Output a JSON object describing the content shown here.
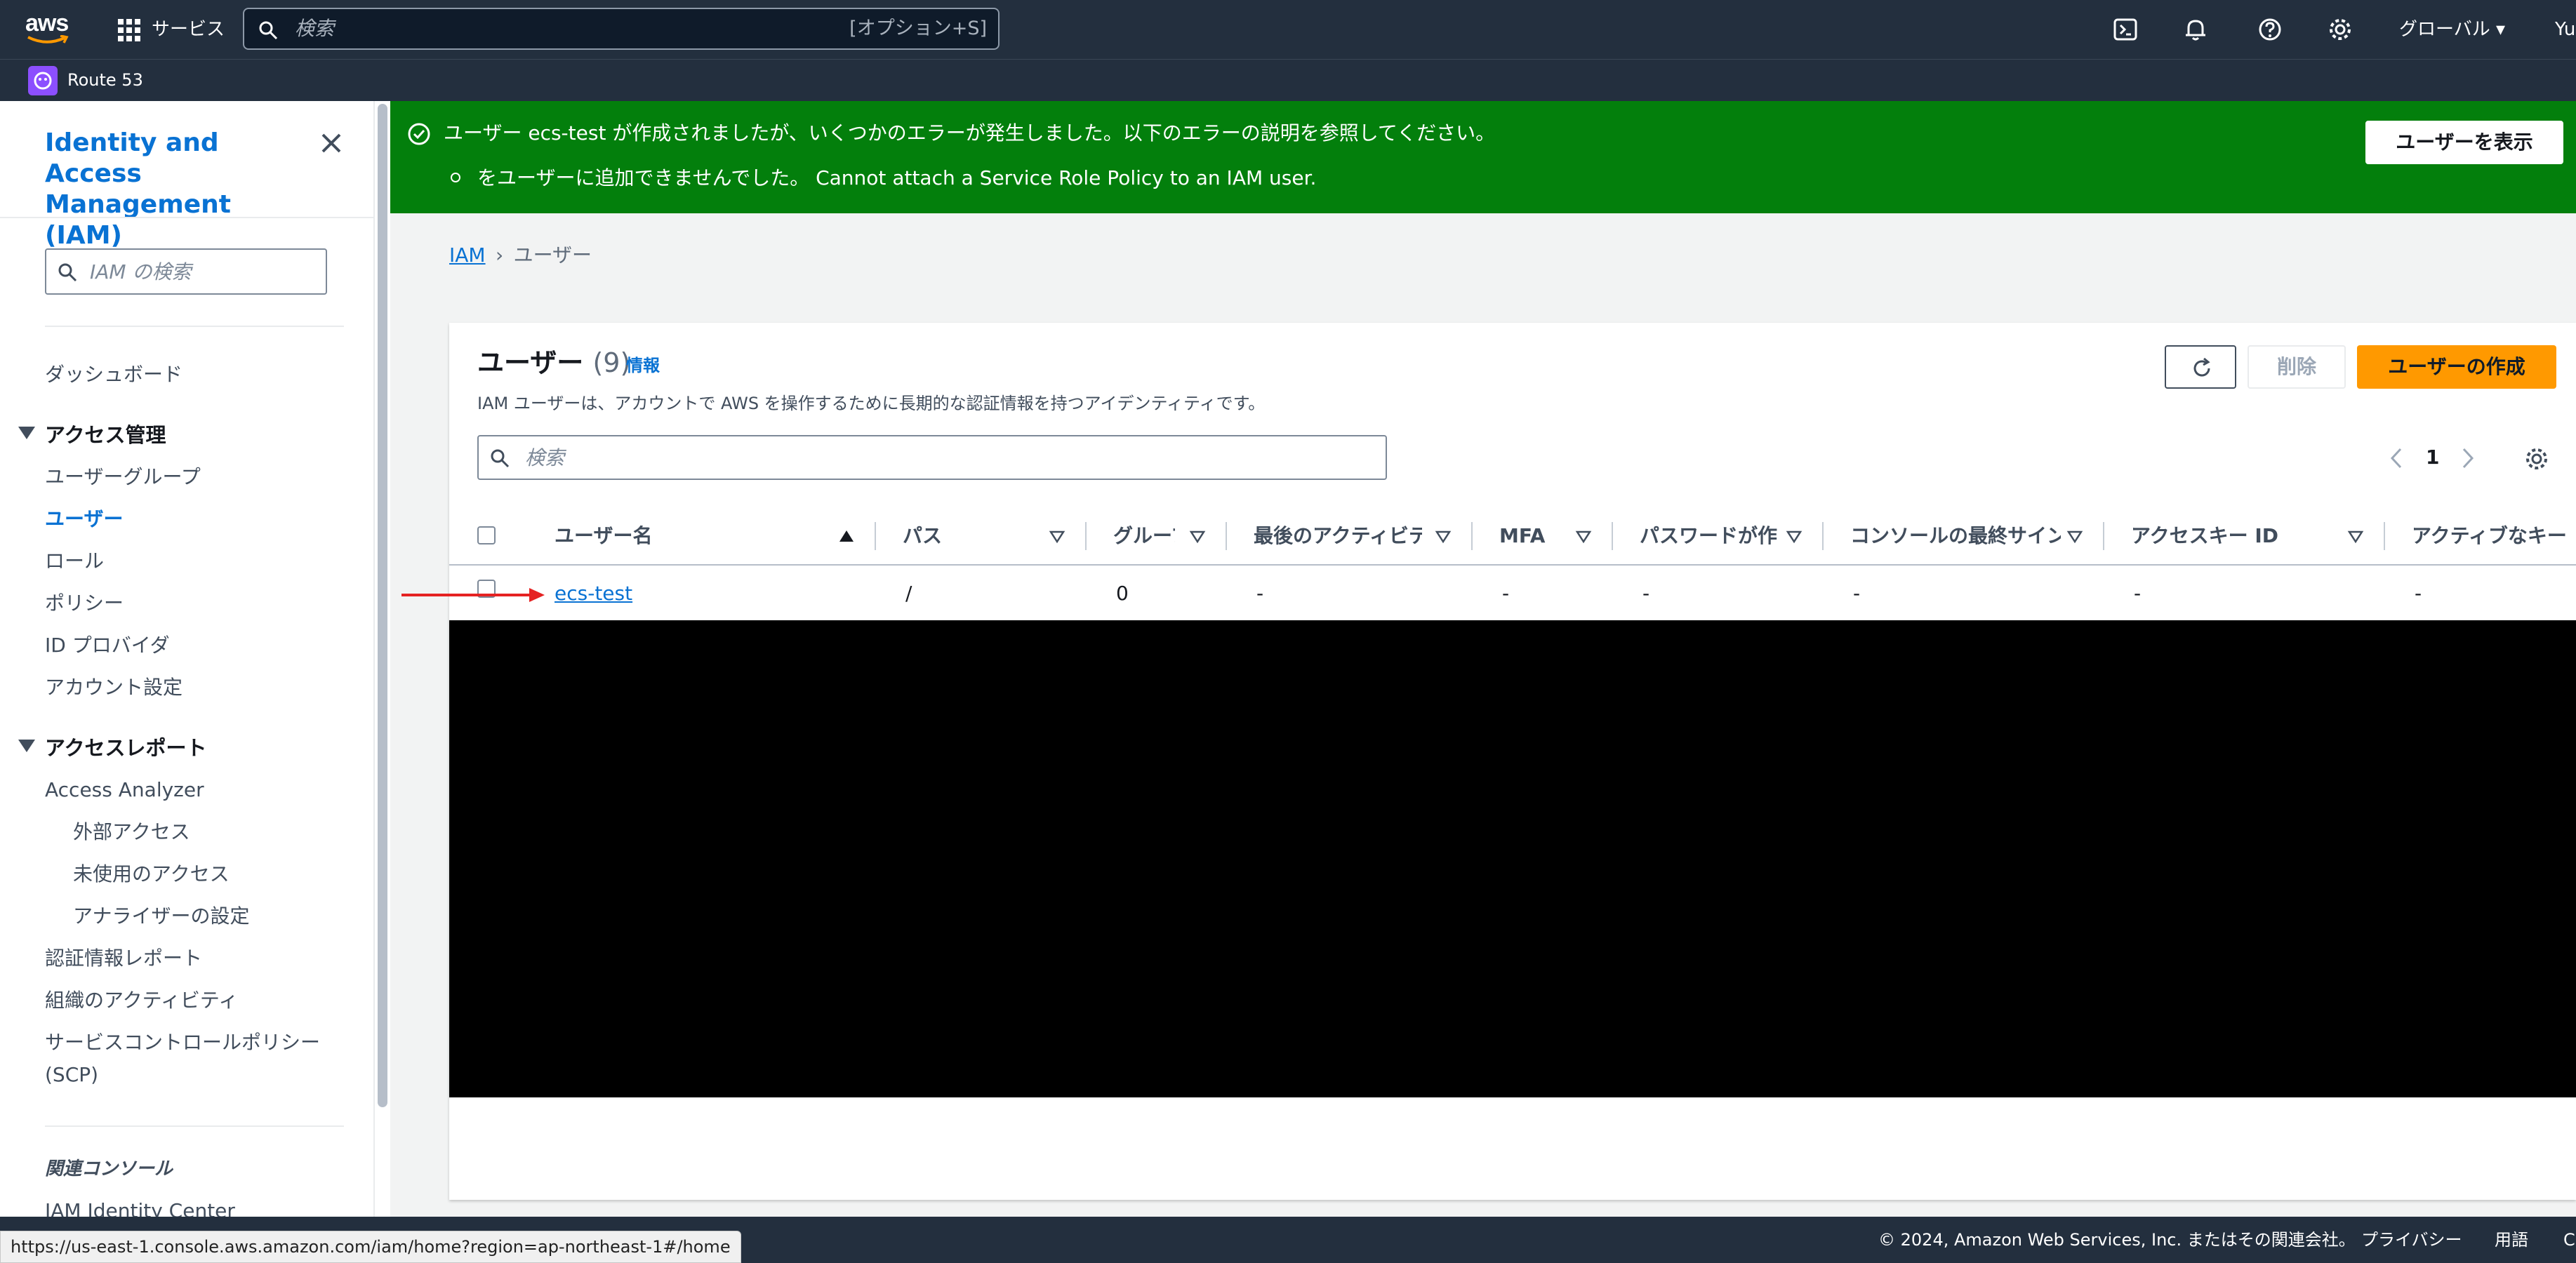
{
  "topbar": {
    "logo_text": "aws",
    "services_label": "サービス",
    "search_placeholder": "検索",
    "search_shortcut": "[オプション+S]",
    "region_label": "グローバル ▾",
    "user_label": "Yu"
  },
  "favorites": {
    "route53_label": "Route 53"
  },
  "sidebar": {
    "title": "Identity and Access Management (IAM)",
    "search_placeholder": "IAM の検索",
    "dashboard": "ダッシュボード",
    "access_management": {
      "heading": "アクセス管理",
      "items": [
        "ユーザーグループ",
        "ユーザー",
        "ロール",
        "ポリシー",
        "ID プロバイダ",
        "アカウント設定"
      ]
    },
    "access_reports": {
      "heading": "アクセスレポート",
      "analyzer": "Access Analyzer",
      "analyzer_items": [
        "外部アクセス",
        "未使用のアクセス",
        "アナライザーの設定"
      ],
      "items": [
        "認証情報レポート",
        "組織のアクティビティ",
        "サービスコントロールポリシー",
        "(SCP)"
      ]
    },
    "related_heading": "関連コンソール",
    "related_item": "IAM Identity Center"
  },
  "flash": {
    "message": "ユーザー ecs-test が作成されましたが、いくつかのエラーが発生しました。以下のエラーの説明を参照してください。",
    "detail": "をユーザーに追加できませんでした。 Cannot attach a Service Role Policy to an IAM user.",
    "button": "ユーザーを表示"
  },
  "breadcrumb": {
    "root": "IAM",
    "current": "ユーザー"
  },
  "users_panel": {
    "title": "ユーザー",
    "count": "(9)",
    "info": "情報",
    "description": "IAM ユーザーは、アカウントで AWS を操作するために長期的な認証情報を持つアイデンティティです。",
    "refresh_icon": "refresh-icon",
    "delete_label": "削除",
    "create_label": "ユーザーの作成",
    "search_placeholder": "検索",
    "page": "1",
    "columns": [
      "ユーザー名",
      "パス",
      "グループ",
      "最後のアクティビティ",
      "MFA",
      "パスワードが作成された時間",
      "コンソールの最終サインイン",
      "アクセスキー ID",
      "アクティブなキー"
    ],
    "rows": [
      {
        "username": "ecs-test",
        "path": "/",
        "groups": "0",
        "last_activity": "-",
        "mfa": "-",
        "password_age": "-",
        "console_last_signin": "-",
        "access_key_id": "-",
        "active_key": "-"
      }
    ]
  },
  "footer": {
    "copyright": "© 2024, Amazon Web Services, Inc. またはその関連会社。",
    "privacy": "プライバシー",
    "terms": "用語",
    "cookie": "C"
  },
  "status_url": "https://us-east-1.console.aws.amazon.com/iam/home?region=ap-northeast-1#/home",
  "colors": {
    "nav_bg": "#232f3e",
    "link_blue": "#0972d3",
    "success_green": "#037f0c",
    "primary_orange": "#ff9900",
    "annotation_red": "#e52222"
  }
}
